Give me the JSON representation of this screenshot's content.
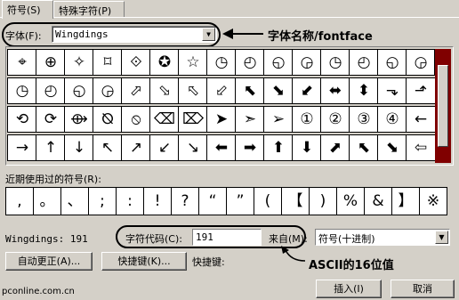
{
  "tabs": [
    {
      "label": "符号(S)"
    },
    {
      "label": "特殊字符(P)"
    }
  ],
  "font": {
    "label": "字体(F):",
    "value": "Wingdings"
  },
  "callouts": {
    "font": "字体名称/fontface",
    "code": "ASCII的16位值"
  },
  "symbol_rows": [
    [
      "⌖",
      "⊕",
      "✧",
      "⌑",
      "⟐",
      "✪",
      "☆",
      "◷",
      "◴",
      "◵",
      "◶",
      "◷",
      "◴",
      "◵",
      "◶"
    ],
    [
      "◷",
      "◴",
      "◵",
      "◶",
      "⬀",
      "⬂",
      "⬁",
      "⬃",
      "⬉",
      "⬊",
      "⬋",
      "⬌",
      "⬍",
      "⬎",
      "⬏"
    ],
    [
      "⟲",
      "⟳",
      "⟴",
      "⦰",
      "⦸",
      "⌫",
      "⌦",
      "➤",
      "➣",
      "➢",
      "①",
      "②",
      "③",
      "④",
      "←"
    ],
    [
      "→",
      "↑",
      "↓",
      "↖",
      "↗",
      "↙",
      "↘",
      "⬅",
      "➡",
      "⬆",
      "⬇",
      "⬈",
      "⬉",
      "⬊",
      "⇦"
    ]
  ],
  "selected_symbol": "⟶",
  "recent_label": "近期使用过的符号(R):",
  "recent_symbols": [
    ",",
    "。",
    "、",
    ";",
    ":",
    "!",
    "?",
    "“",
    "”",
    "(",
    "【",
    ")",
    "%",
    "&",
    "】",
    "※"
  ],
  "status": {
    "font_code": "Wingdings: 191",
    "char_code_label": "字符代码(C):",
    "char_code_value": "191",
    "from_label": "来自(M):",
    "from_value": "符号(十进制)"
  },
  "buttons": {
    "autocorrect": "自动更正(A)...",
    "shortcut": "快捷键(K)...",
    "shortcut_status": "快捷键:",
    "insert": "插入(I)",
    "cancel": "取消"
  },
  "watermark": "pconline.com.cn"
}
